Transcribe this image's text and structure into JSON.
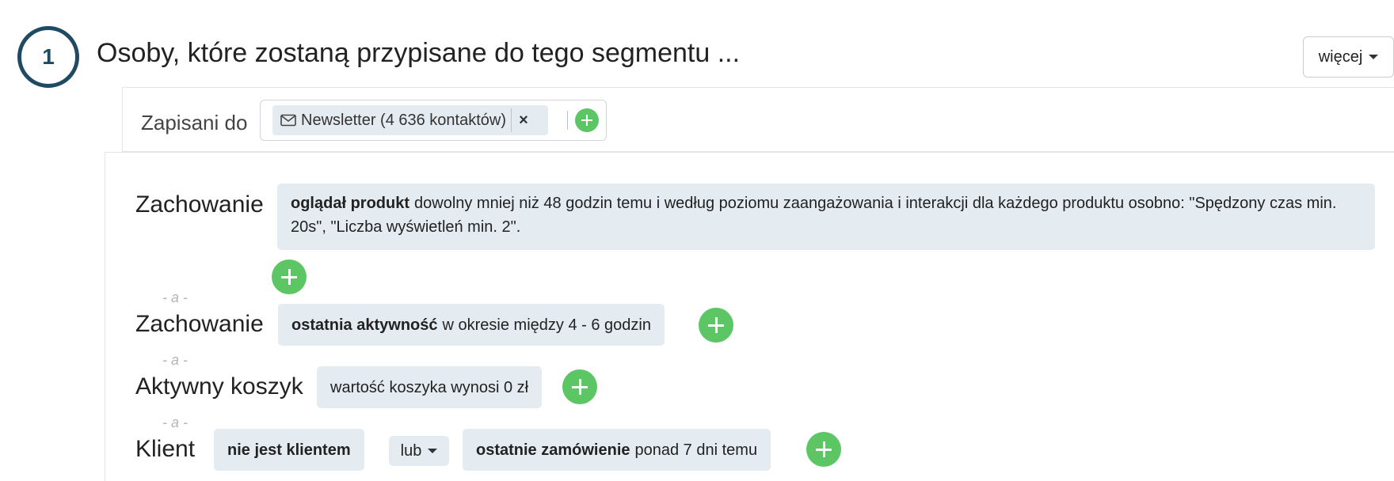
{
  "header": {
    "step_number": "1",
    "title": "Osoby, które zostaną przypisane do tego segmentu ...",
    "more_label": "więcej"
  },
  "subscribed": {
    "label": "Zapisani do",
    "tag_text": "Newsletter (4 636 kontaktów)",
    "remove_symbol": "×"
  },
  "conditions": {
    "and_label": "- a -",
    "or_label": "lub",
    "rows": [
      {
        "label": "Zachowanie",
        "bold": "oglądał produkt",
        "text": "dowolny mniej niż 48 godzin temu i według poziomu zaangażowania i interakcji dla każdego produktu osobno: \"Spędzony czas min. 20s\", \"Liczba wyświetleń min. 2\"."
      },
      {
        "label": "Zachowanie",
        "bold": "ostatnia aktywność",
        "text": "w okresie między 4 - 6 godzin"
      },
      {
        "label": "Aktywny koszyk",
        "text": "wartość koszyka wynosi 0 zł"
      },
      {
        "label": "Klient",
        "first_bold": "nie jest klientem",
        "second_bold": "ostatnie zamówienie",
        "second_text": "ponad 7 dni temu"
      }
    ]
  },
  "colors": {
    "accent_dark": "#1f4a63",
    "add_green": "#5cc665",
    "chip_bg": "#e4ecf2"
  }
}
